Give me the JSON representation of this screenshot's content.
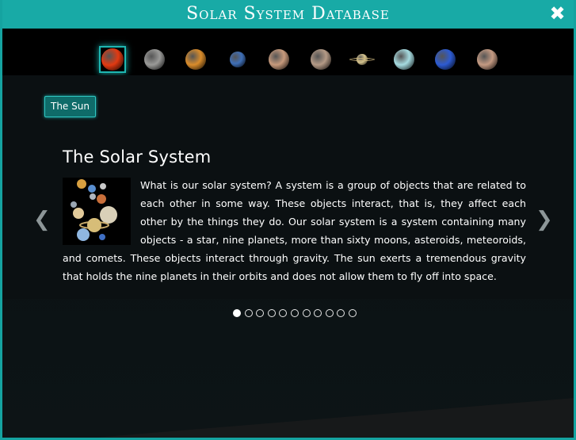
{
  "window": {
    "title": "Solar System Database",
    "close_icon": "close-icon"
  },
  "planet_bar": {
    "items": [
      {
        "name": "sun",
        "selected": true,
        "color": "#e23a12"
      },
      {
        "name": "mercury",
        "selected": false,
        "color": "#9a9a98"
      },
      {
        "name": "venus",
        "selected": false,
        "color": "#d98c2b"
      },
      {
        "name": "earth",
        "selected": false,
        "color": "#3f6fb6"
      },
      {
        "name": "mars",
        "selected": false,
        "color": "#c79a7c"
      },
      {
        "name": "jupiter",
        "selected": false,
        "color": "#b49a86"
      },
      {
        "name": "saturn",
        "selected": false,
        "color": "#d8c690"
      },
      {
        "name": "uranus",
        "selected": false,
        "color": "#a6dbe0"
      },
      {
        "name": "neptune",
        "selected": false,
        "color": "#2d5bd2"
      },
      {
        "name": "pluto",
        "selected": false,
        "color": "#c49a82"
      }
    ]
  },
  "tag": {
    "label": "The Sun"
  },
  "article": {
    "heading": "The Solar System",
    "body": "What is our solar system? A system is a group of objects that are related to each other in some way. These objects interact, that is, they affect each other by the things they do. Our solar system is a system containing many objects - a star, nine planets, more than sixty moons, asteroids, meteoroids, and comets. These objects interact through gravity. The sun exerts a tremendous gravity that holds the nine planets in their orbits and does not allow them to fly off into space."
  },
  "carousel": {
    "active_page": 1,
    "page_count": 11
  },
  "colors": {
    "accent": "#18aaa6",
    "background": "#0b1012"
  }
}
